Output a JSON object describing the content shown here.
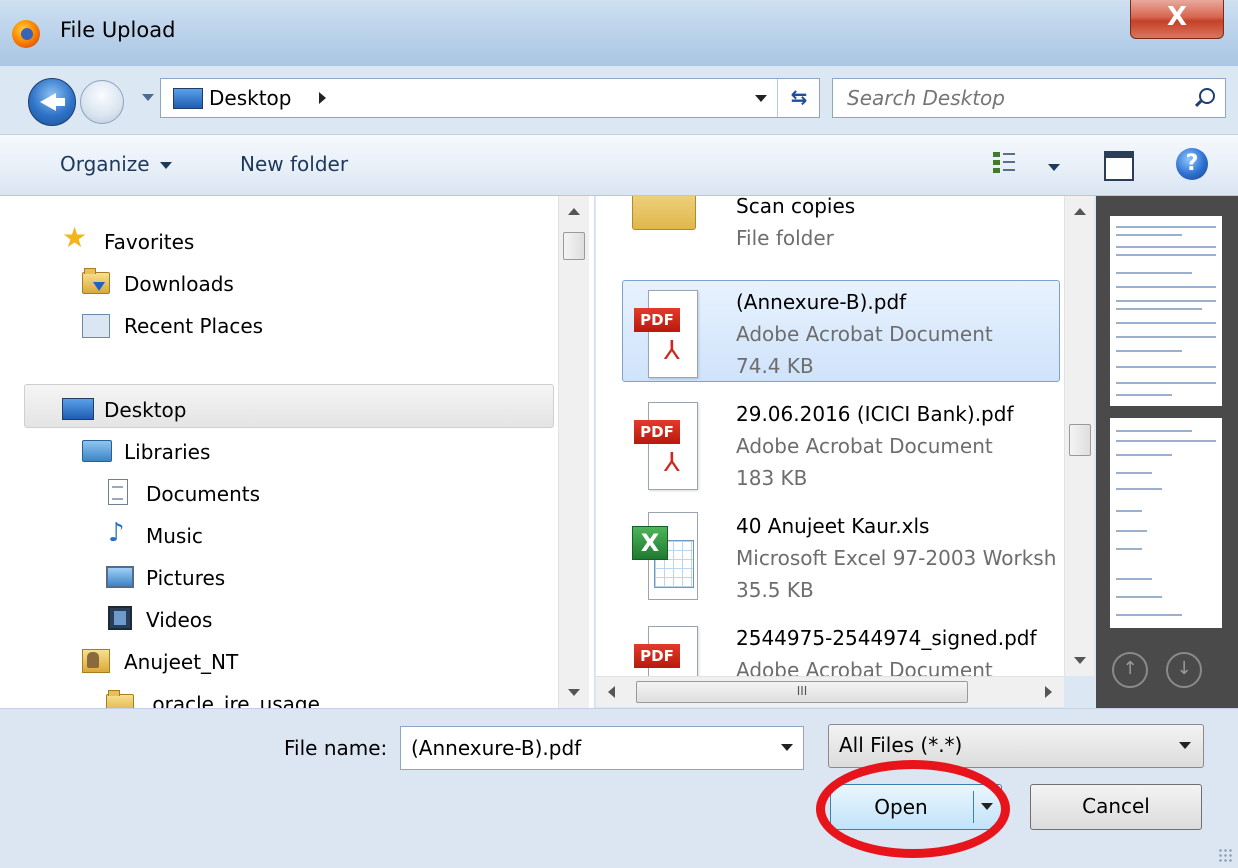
{
  "window": {
    "title": "File Upload",
    "close_label": "X"
  },
  "nav": {
    "address": "Desktop",
    "search_placeholder": "Search Desktop"
  },
  "toolbar": {
    "organize_label": "Organize",
    "new_folder_label": "New folder",
    "help_label": "?"
  },
  "navpane": {
    "items": [
      {
        "label": "Favorites",
        "icon": "star-icon"
      },
      {
        "label": "Downloads",
        "icon": "downloads-folder-icon"
      },
      {
        "label": "Recent Places",
        "icon": "recent-places-icon"
      },
      {
        "label": "Desktop",
        "icon": "desktop-icon",
        "selected": true
      },
      {
        "label": "Libraries",
        "icon": "libraries-icon"
      },
      {
        "label": "Documents",
        "icon": "documents-icon"
      },
      {
        "label": "Music",
        "icon": "music-icon"
      },
      {
        "label": "Pictures",
        "icon": "pictures-icon"
      },
      {
        "label": "Videos",
        "icon": "videos-icon"
      },
      {
        "label": "Anujeet_NT",
        "icon": "user-folder-icon"
      },
      {
        "label": ".oracle_jre_usage",
        "icon": "folder-icon"
      }
    ]
  },
  "files": [
    {
      "name": "Scan copies",
      "type": "File folder",
      "size": ""
    },
    {
      "name": "(Annexure-B).pdf",
      "type": "Adobe Acrobat Document",
      "size": "74.4 KB",
      "selected": true
    },
    {
      "name": "29.06.2016 (ICICI Bank).pdf",
      "type": "Adobe Acrobat Document",
      "size": "183 KB"
    },
    {
      "name": "40 Anujeet Kaur.xls",
      "type": "Microsoft Excel 97-2003 Worksh",
      "size": "35.5 KB"
    },
    {
      "name": "2544975-2544974_signed.pdf",
      "type": "Adobe Acrobat Document",
      "size": ""
    }
  ],
  "icons": {
    "pdf_badge": "PDF",
    "xls_badge": "X",
    "hscroll_grip": "III"
  },
  "bottom": {
    "filename_label": "File name:",
    "filename_value": "(Annexure-B).pdf",
    "filetype_value": "All Files (*.*)",
    "open_label": "Open",
    "cancel_label": "Cancel"
  },
  "colors": {
    "highlight_circle": "#e8141b",
    "selection": "#cfe3fb"
  }
}
